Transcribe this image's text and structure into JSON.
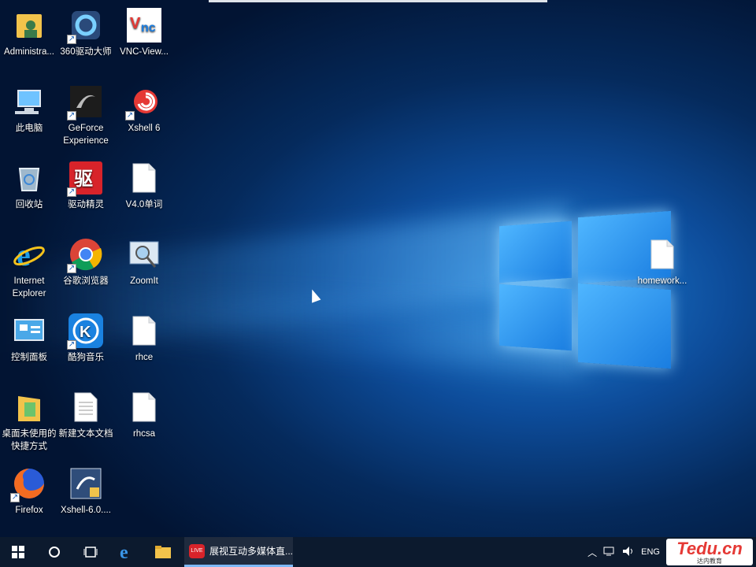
{
  "desktop": {
    "icons": [
      {
        "label": "Administra...",
        "icon": "user-folder-icon"
      },
      {
        "label": "360驱动大师",
        "icon": "360-driver-icon"
      },
      {
        "label": "VNC-View...",
        "icon": "vnc-icon"
      },
      {
        "label": "此电脑",
        "icon": "this-pc-icon"
      },
      {
        "label": "GeForce Experience",
        "icon": "geforce-icon"
      },
      {
        "label": "Xshell 6",
        "icon": "xshell-icon"
      },
      {
        "label": "回收站",
        "icon": "recycle-bin-icon"
      },
      {
        "label": "驱动精灵",
        "icon": "driver-genius-icon"
      },
      {
        "label": "V4.0单词",
        "icon": "blank-file-icon"
      },
      {
        "label": "Internet Explorer",
        "icon": "ie-icon"
      },
      {
        "label": "谷歌浏览器",
        "icon": "chrome-icon"
      },
      {
        "label": "ZoomIt",
        "icon": "zoomit-icon"
      },
      {
        "label": "控制面板",
        "icon": "control-panel-icon"
      },
      {
        "label": "酷狗音乐",
        "icon": "kugou-icon"
      },
      {
        "label": "rhce",
        "icon": "blank-file-icon"
      },
      {
        "label": "桌面未使用的快捷方式",
        "icon": "folder-icon"
      },
      {
        "label": "新建文本文档",
        "icon": "text-file-icon"
      },
      {
        "label": "rhcsa",
        "icon": "blank-file-icon"
      },
      {
        "label": "Firefox",
        "icon": "firefox-icon"
      },
      {
        "label": "Xshell-6.0....",
        "icon": "installer-icon"
      },
      {
        "label": "homework...",
        "icon": "blank-file-icon"
      }
    ]
  },
  "taskbar": {
    "start_icon": "windows-start-icon",
    "search_icon": "cortana-circle-icon",
    "taskview_icon": "task-view-icon",
    "pinned": [
      "edge-icon",
      "file-explorer-icon"
    ],
    "running_app": {
      "label": "展视互动多媒体直...",
      "icon": "live-app-icon"
    },
    "tray": {
      "language": "ENG"
    },
    "watermark": {
      "brand": "Tedu.cn",
      "sub": "达内教育"
    }
  }
}
